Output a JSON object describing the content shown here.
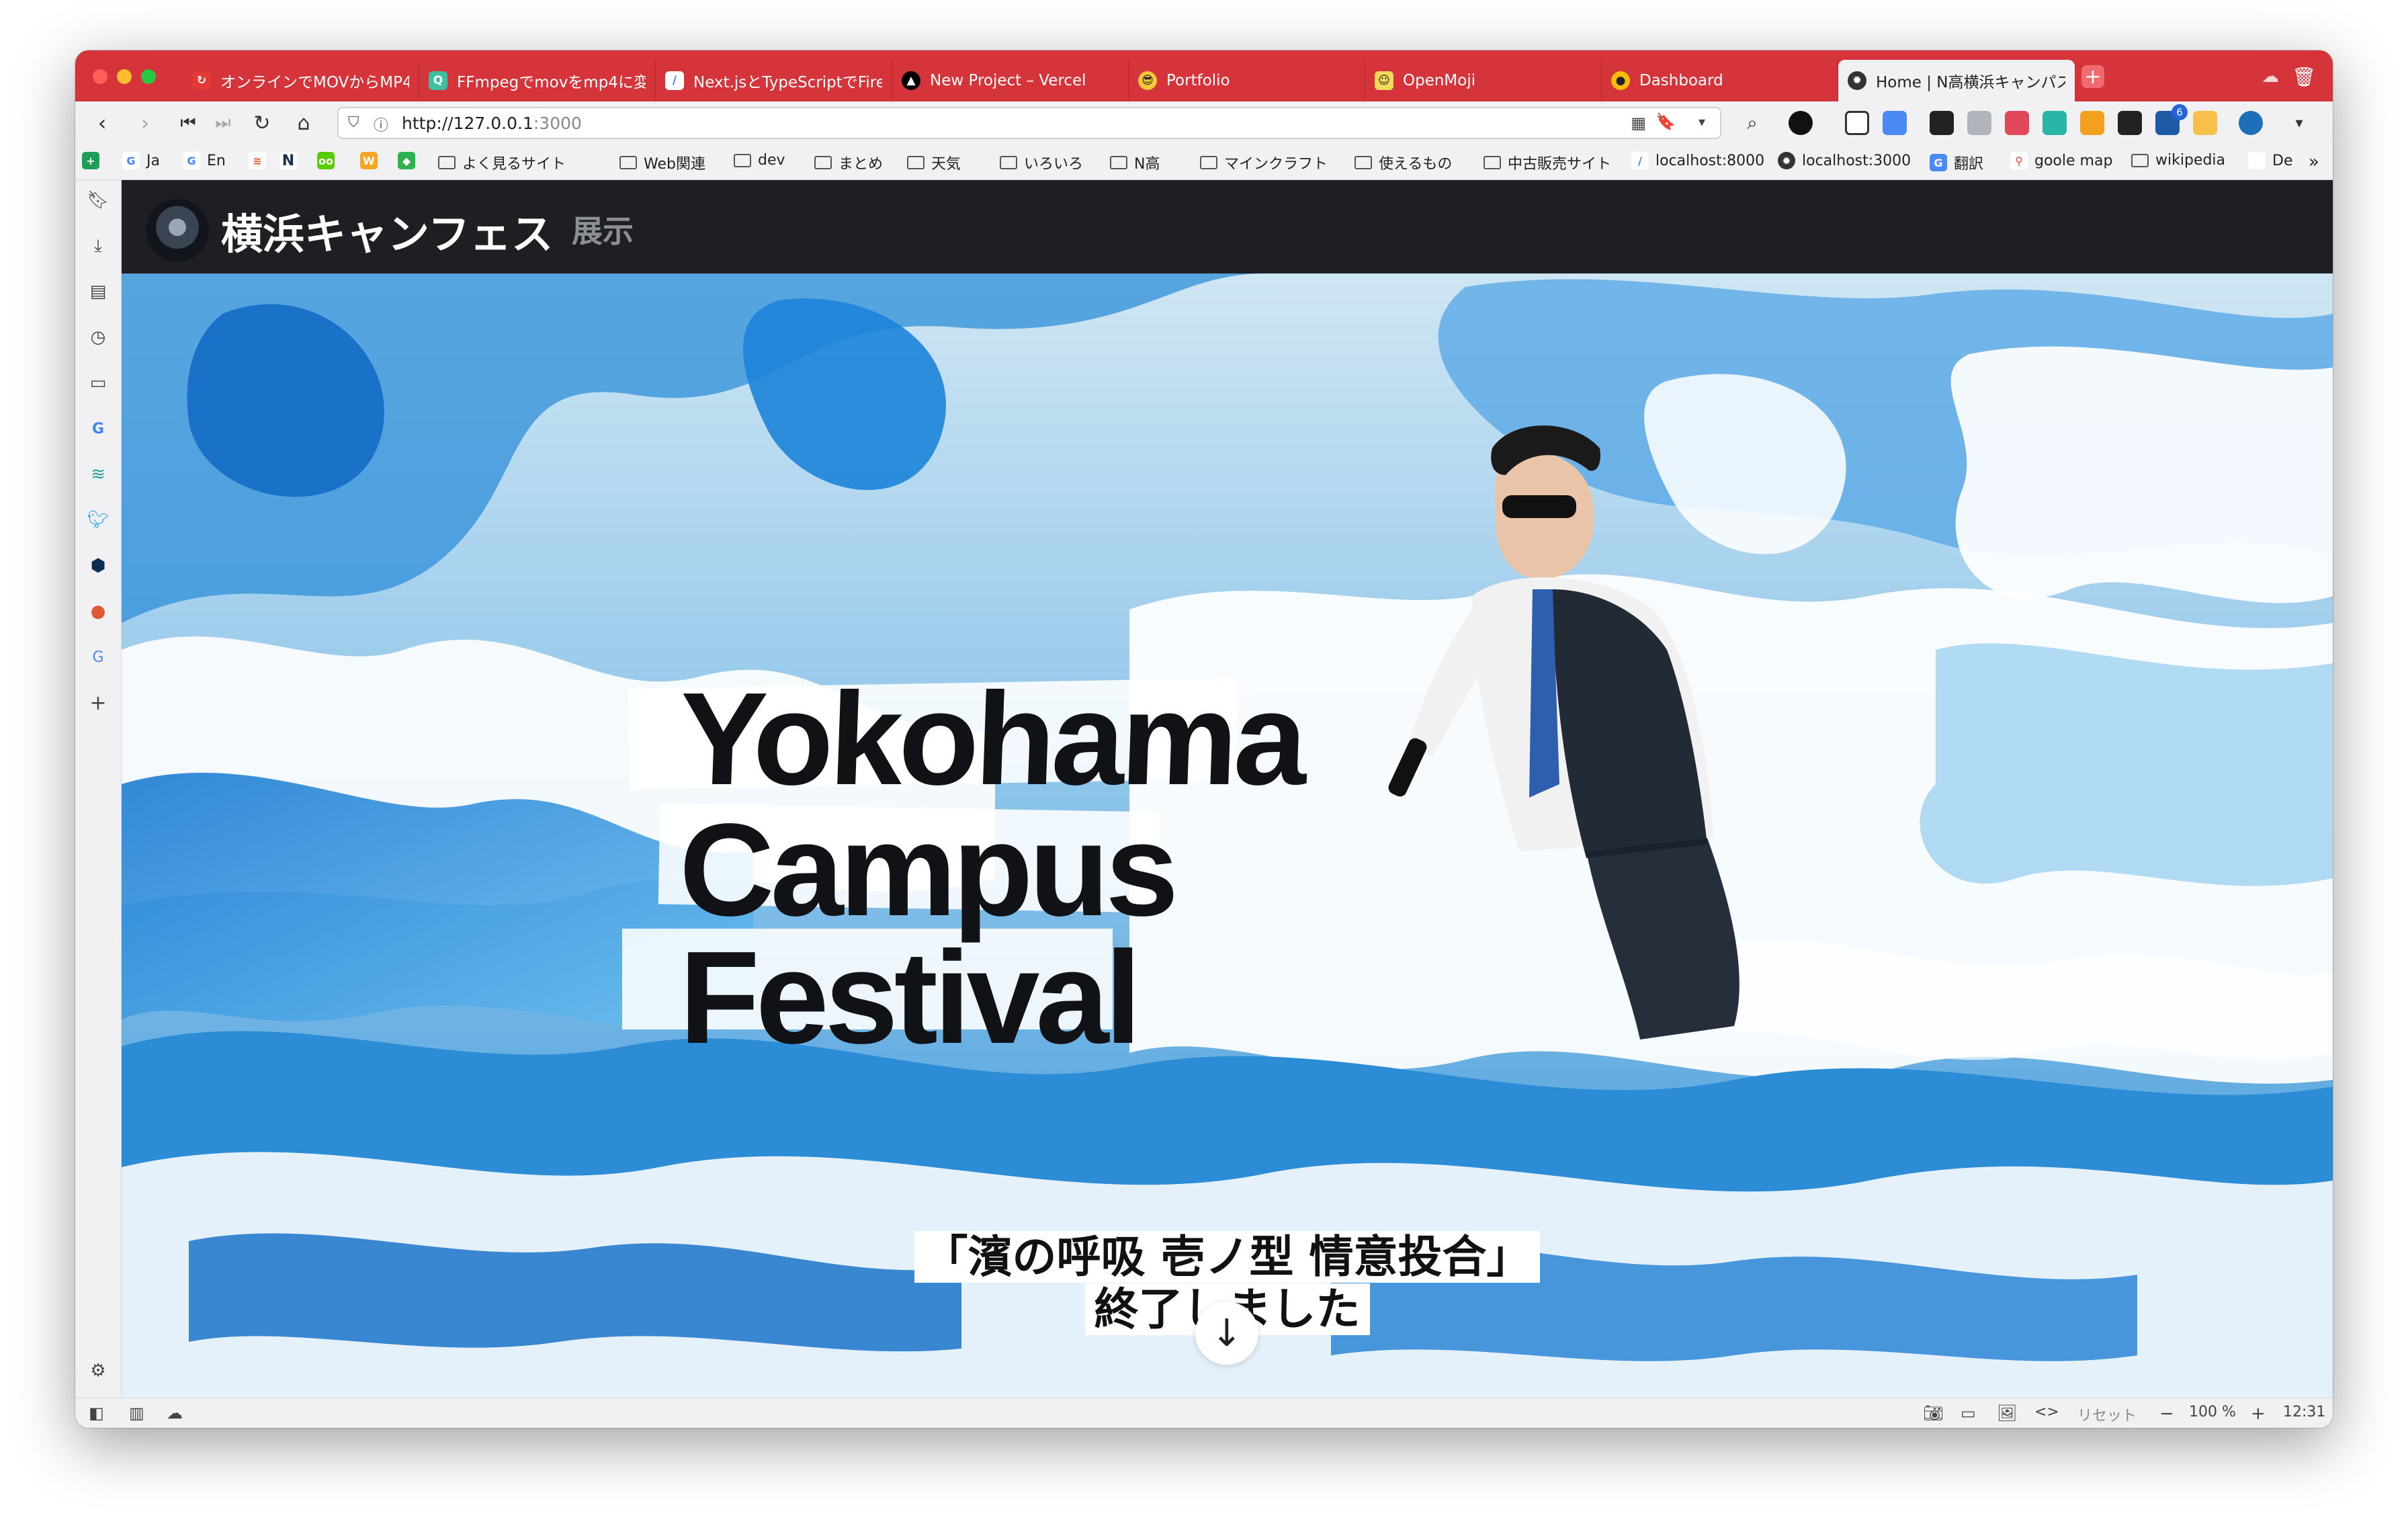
{
  "browser": {
    "tabs": [
      {
        "label": "オンラインでMOVからMP4"
      },
      {
        "label": "FFmpegでmovをmp4に変"
      },
      {
        "label": "Next.jsとTypeScriptでFirel"
      },
      {
        "label": "New Project – Vercel"
      },
      {
        "label": "Portfolio"
      },
      {
        "label": "OpenMoji"
      },
      {
        "label": "Dashboard"
      },
      {
        "label": "Home | N高横浜キャンパス"
      }
    ],
    "url": {
      "host": "http://127.0.0.1",
      "port": ":3000"
    },
    "bookmarks": [
      {
        "label": "Ja"
      },
      {
        "label": "En"
      },
      {
        "label": "よく見るサイト"
      },
      {
        "label": "Web関連"
      },
      {
        "label": "dev"
      },
      {
        "label": "まとめ"
      },
      {
        "label": "天気"
      },
      {
        "label": "いろいろ"
      },
      {
        "label": "N高"
      },
      {
        "label": "マインクラフト"
      },
      {
        "label": "使えるもの"
      },
      {
        "label": "中古販売サイト"
      },
      {
        "label": "localhost:8000"
      },
      {
        "label": "localhost:3000"
      },
      {
        "label": "翻訳"
      },
      {
        "label": "goole map"
      },
      {
        "label": "wikipedia"
      },
      {
        "label": "De"
      }
    ],
    "ext_badge": "6",
    "status": {
      "reset": "リセット",
      "zoom": "100 %",
      "time": "12:31"
    }
  },
  "site": {
    "title": "横浜キャンフェス",
    "nav": "展示",
    "hero": {
      "title_lines": [
        "Yokohama",
        "Campus",
        "Festival"
      ],
      "announcement_line1": "「濱の呼吸 壱ノ型 情意投合」",
      "announcement_line2": "終了しました"
    }
  },
  "colors": {
    "tabbar": "#d5343a",
    "chrome": "#f1f1f3",
    "site_header": "#1d1f22",
    "hero_blue": "#2f8fd8"
  },
  "icons": {
    "scroll_down": "arrow-down-icon"
  }
}
